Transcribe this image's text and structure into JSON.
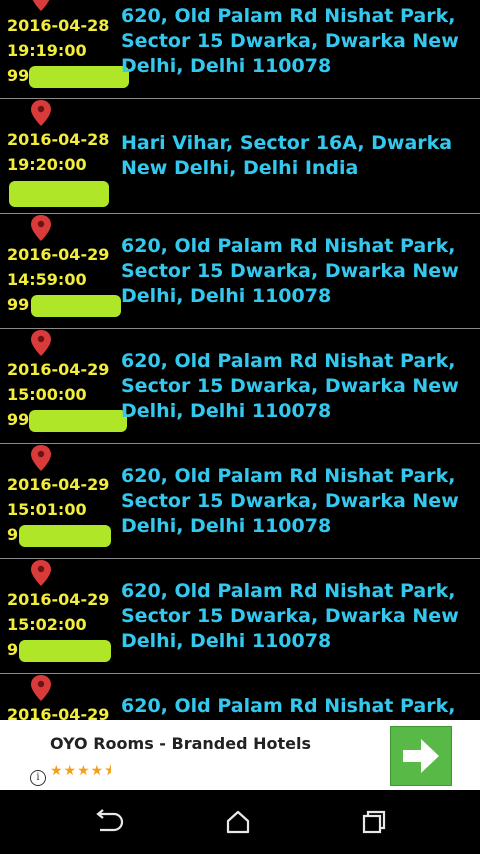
{
  "entries": [
    {
      "date": "2016-04-28",
      "time": "19:19:00",
      "phone_visible": "99",
      "address": "620, Old Palam Rd Nishat Park, Sector 15 Dwarka, Dwarka New Delhi, Delhi 110078"
    },
    {
      "date": "2016-04-28",
      "time": "19:20:00",
      "phone_visible": "",
      "address": "Hari Vihar, Sector 16A, Dwarka New Delhi, Delhi India"
    },
    {
      "date": "2016-04-29",
      "time": "14:59:00",
      "phone_visible": "99",
      "address": "620, Old Palam Rd Nishat Park, Sector 15 Dwarka, Dwarka New Delhi, Delhi 110078"
    },
    {
      "date": "2016-04-29",
      "time": "15:00:00",
      "phone_visible": "99",
      "address": "620, Old Palam Rd Nishat Park, Sector 15 Dwarka, Dwarka New Delhi, Delhi 110078"
    },
    {
      "date": "2016-04-29",
      "time": "15:01:00",
      "phone_visible": "9",
      "address": "620, Old Palam Rd Nishat Park, Sector 15 Dwarka, Dwarka New Delhi, Delhi 110078"
    },
    {
      "date": "2016-04-29",
      "time": "15:02:00",
      "phone_visible": "9",
      "address": "620, Old Palam Rd Nishat Park, Sector 15 Dwarka, Dwarka New Delhi, Delhi 110078"
    },
    {
      "date": "2016-04-29",
      "time": "",
      "phone_visible": "",
      "address": "620, Old Palam Rd Nishat Park,"
    }
  ],
  "ad": {
    "title": "OYO Rooms - Branded Hotels",
    "rating_stars": "★★★★⯨",
    "rating": 4.5,
    "info_icon": "i"
  },
  "colors": {
    "date": "#f2ec3a",
    "address": "#35c8ee",
    "pin": "#d93a3a",
    "redaction": "#b8f22a",
    "ad_button": "#58b947"
  }
}
